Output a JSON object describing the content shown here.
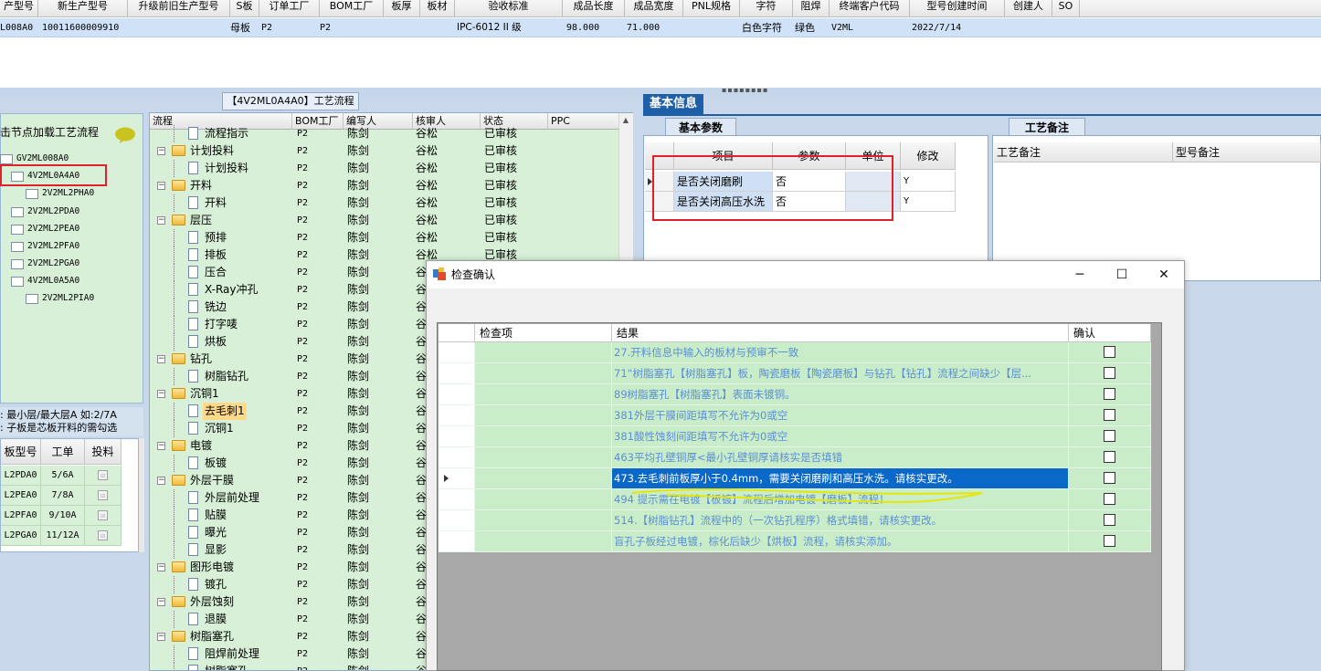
{
  "top_grid": {
    "headers": [
      "产型号",
      "新生产型号",
      "升级前旧生产型号",
      "S板",
      "订单工厂",
      "BOM工厂",
      "板厚",
      "板材",
      "验收标准",
      "成品长度",
      "成品宽度",
      "PNL规格",
      "字符",
      "阻焊",
      "终端客户代码",
      "型号创建时间",
      "创建人",
      "SO"
    ],
    "row": {
      "old_model": "L008A0",
      "new_model": "10011600009910",
      "s_board": "母板",
      "order_factory": "P2",
      "bom_factory": "P2",
      "standard": "IPC-6012 II 级",
      "length": "98.000",
      "width": "71.000",
      "character": "白色字符",
      "solder_mask": "绿色",
      "customer_code": "V2ML",
      "created": "2022/7/14"
    }
  },
  "left_panel": {
    "tree_title": "击节点加载工艺流程",
    "items": [
      {
        "label": "GV2ML008A0",
        "highlighted": false
      },
      {
        "label": "4V2ML0A4A0",
        "highlighted": true
      },
      {
        "label": "2V2ML2PHA0",
        "highlighted": false
      },
      {
        "label": "2V2ML2PDA0",
        "highlighted": false
      },
      {
        "label": "2V2ML2PEA0",
        "highlighted": false
      },
      {
        "label": "2V2ML2PFA0",
        "highlighted": false
      },
      {
        "label": "2V2ML2PGA0",
        "highlighted": false
      },
      {
        "label": "4V2ML0A5A0",
        "highlighted": false
      },
      {
        "label": "2V2ML2PIA0",
        "highlighted": false
      }
    ],
    "note_line1": ": 最小层/最大层A 如:2/7A",
    "note_line2": ": 子板是芯板开料的需勾选",
    "grid_headers": [
      "板型号",
      "工单",
      "投料"
    ],
    "grid_rows": [
      {
        "model": "L2PDA0",
        "order": "5/6A",
        "check": "☑"
      },
      {
        "model": "L2PEA0",
        "order": "7/8A",
        "check": "☑"
      },
      {
        "model": "L2PFA0",
        "order": "9/10A",
        "check": "☑"
      },
      {
        "model": "L2PGA0",
        "order": "11/12A",
        "check": "☑"
      }
    ]
  },
  "process_panel": {
    "title": "【4V2ML0A4A0】工艺流程",
    "headers": [
      "流程",
      "BOM工厂",
      "编写人",
      "核审人",
      "状态",
      "PPC"
    ],
    "rows": [
      {
        "name": "流程指示",
        "level": 2,
        "folder": false,
        "bom": "P2",
        "writer": "陈剑",
        "reviewer": "谷松",
        "status": "已审核"
      },
      {
        "name": "计划投料",
        "level": 1,
        "folder": true,
        "bom": "P2",
        "writer": "陈剑",
        "reviewer": "谷松",
        "status": "已审核"
      },
      {
        "name": "计划投料",
        "level": 2,
        "folder": false,
        "bom": "P2",
        "writer": "陈剑",
        "reviewer": "谷松",
        "status": "已审核"
      },
      {
        "name": "开料",
        "level": 1,
        "folder": true,
        "bom": "P2",
        "writer": "陈剑",
        "reviewer": "谷松",
        "status": "已审核"
      },
      {
        "name": "开料",
        "level": 2,
        "folder": false,
        "bom": "P2",
        "writer": "陈剑",
        "reviewer": "谷松",
        "status": "已审核"
      },
      {
        "name": "层压",
        "level": 1,
        "folder": true,
        "bom": "P2",
        "writer": "陈剑",
        "reviewer": "谷松",
        "status": "已审核"
      },
      {
        "name": "预排",
        "level": 2,
        "folder": false,
        "bom": "P2",
        "writer": "陈剑",
        "reviewer": "谷松",
        "status": "已审核"
      },
      {
        "name": "排板",
        "level": 2,
        "folder": false,
        "bom": "P2",
        "writer": "陈剑",
        "reviewer": "谷松",
        "status": "已审核"
      },
      {
        "name": "压合",
        "level": 2,
        "folder": false,
        "bom": "P2",
        "writer": "陈剑",
        "reviewer": "谷",
        "status": ""
      },
      {
        "name": "X-Ray冲孔",
        "level": 2,
        "folder": false,
        "bom": "P2",
        "writer": "陈剑",
        "reviewer": "谷",
        "status": ""
      },
      {
        "name": "铣边",
        "level": 2,
        "folder": false,
        "bom": "P2",
        "writer": "陈剑",
        "reviewer": "谷",
        "status": ""
      },
      {
        "name": "打字唛",
        "level": 2,
        "folder": false,
        "bom": "P2",
        "writer": "陈剑",
        "reviewer": "谷",
        "status": ""
      },
      {
        "name": "烘板",
        "level": 2,
        "folder": false,
        "bom": "P2",
        "writer": "陈剑",
        "reviewer": "谷",
        "status": ""
      },
      {
        "name": "钻孔",
        "level": 1,
        "folder": true,
        "bom": "P2",
        "writer": "陈剑",
        "reviewer": "谷",
        "status": ""
      },
      {
        "name": "树脂钻孔",
        "level": 2,
        "folder": false,
        "bom": "P2",
        "writer": "陈剑",
        "reviewer": "谷",
        "status": ""
      },
      {
        "name": "沉铜1",
        "level": 1,
        "folder": true,
        "bom": "P2",
        "writer": "陈剑",
        "reviewer": "谷",
        "status": ""
      },
      {
        "name": "去毛刺1",
        "level": 2,
        "folder": false,
        "bom": "P2",
        "writer": "陈剑",
        "reviewer": "谷",
        "status": "",
        "selected": true
      },
      {
        "name": "沉铜1",
        "level": 2,
        "folder": false,
        "bom": "P2",
        "writer": "陈剑",
        "reviewer": "谷",
        "status": ""
      },
      {
        "name": "电镀",
        "level": 1,
        "folder": true,
        "bom": "P2",
        "writer": "陈剑",
        "reviewer": "谷",
        "status": ""
      },
      {
        "name": "板镀",
        "level": 2,
        "folder": false,
        "bom": "P2",
        "writer": "陈剑",
        "reviewer": "谷",
        "status": ""
      },
      {
        "name": "外层干膜",
        "level": 1,
        "folder": true,
        "bom": "P2",
        "writer": "陈剑",
        "reviewer": "谷",
        "status": ""
      },
      {
        "name": "外层前处理",
        "level": 2,
        "folder": false,
        "bom": "P2",
        "writer": "陈剑",
        "reviewer": "谷",
        "status": ""
      },
      {
        "name": "贴膜",
        "level": 2,
        "folder": false,
        "bom": "P2",
        "writer": "陈剑",
        "reviewer": "谷",
        "status": ""
      },
      {
        "name": "曝光",
        "level": 2,
        "folder": false,
        "bom": "P2",
        "writer": "陈剑",
        "reviewer": "谷",
        "status": ""
      },
      {
        "name": "显影",
        "level": 2,
        "folder": false,
        "bom": "P2",
        "writer": "陈剑",
        "reviewer": "谷",
        "status": ""
      },
      {
        "name": "图形电镀",
        "level": 1,
        "folder": true,
        "bom": "P2",
        "writer": "陈剑",
        "reviewer": "谷",
        "status": ""
      },
      {
        "name": "镀孔",
        "level": 2,
        "folder": false,
        "bom": "P2",
        "writer": "陈剑",
        "reviewer": "谷",
        "status": ""
      },
      {
        "name": "外层蚀刻",
        "level": 1,
        "folder": true,
        "bom": "P2",
        "writer": "陈剑",
        "reviewer": "谷",
        "status": ""
      },
      {
        "name": "退膜",
        "level": 2,
        "folder": false,
        "bom": "P2",
        "writer": "陈剑",
        "reviewer": "谷",
        "status": ""
      },
      {
        "name": "树脂塞孔",
        "level": 1,
        "folder": true,
        "bom": "P2",
        "writer": "陈剑",
        "reviewer": "谷",
        "status": ""
      },
      {
        "name": "阻焊前处理",
        "level": 2,
        "folder": false,
        "bom": "P2",
        "writer": "陈剑",
        "reviewer": "谷",
        "status": ""
      },
      {
        "name": "树脂塞孔",
        "level": 2,
        "folder": false,
        "bom": "P2",
        "writer": "陈剑",
        "reviewer": "谷",
        "status": ""
      }
    ]
  },
  "info_panel": {
    "main_tab": "基本信息",
    "param_tab": "基本参数",
    "param_headers": [
      "项目",
      "参数",
      "单位",
      "修改"
    ],
    "param_rows": [
      {
        "item": "是否关闭磨刷",
        "value": "否",
        "unit": "",
        "modify": "Y"
      },
      {
        "item": "是否关闭高压水洗",
        "value": "否",
        "unit": "",
        "modify": "Y"
      }
    ],
    "remark_tab": "工艺备注",
    "remark_headers": [
      "工艺备注",
      "型号备注"
    ]
  },
  "dialog": {
    "title": "检查确认",
    "headers": [
      "检查项",
      "结果",
      "确认"
    ],
    "rows": [
      {
        "result": "27.开料信息中输入的板材与预审不一致",
        "selected": false
      },
      {
        "result": "71“树脂塞孔【树脂塞孔】板，陶瓷磨板【陶瓷磨板】与钻孔【钻孔】流程之间缺少【层...",
        "selected": false
      },
      {
        "result": "89树脂塞孔【树脂塞孔】表面未镀铜。",
        "selected": false
      },
      {
        "result": "381外层干膜间距填写不允许为0或空",
        "selected": false
      },
      {
        "result": "381酸性蚀刻间距填写不允许为0或空",
        "selected": false
      },
      {
        "result": "463平均孔壁铜厚<最小孔壁铜厚请核实是否填错",
        "selected": false
      },
      {
        "result": "473.去毛刺前板厚小于0.4mm，需要关闭磨刷和高压水洗。请核实更改。",
        "selected": true
      },
      {
        "result": "494 提示需在电镀【板镀】流程后增加电镀【磨板】流程！",
        "selected": false
      },
      {
        "result": "514.【树脂钻孔】流程中的（一次钻孔程序）格式填错，请核实更改。",
        "selected": false
      },
      {
        "result": "盲孔子板经过电镀，棕化后缺少【烘板】流程，请核实添加。",
        "selected": false
      }
    ],
    "minimize": "─",
    "maximize": "☐",
    "close": "✕"
  },
  "colors": {
    "grid_green": "#c9ecc9",
    "selected_blue": "#0a68c9",
    "result_text": "#5b8fd6",
    "highlight_red": "#e0202a",
    "tab_blue": "#1f5fa8"
  }
}
